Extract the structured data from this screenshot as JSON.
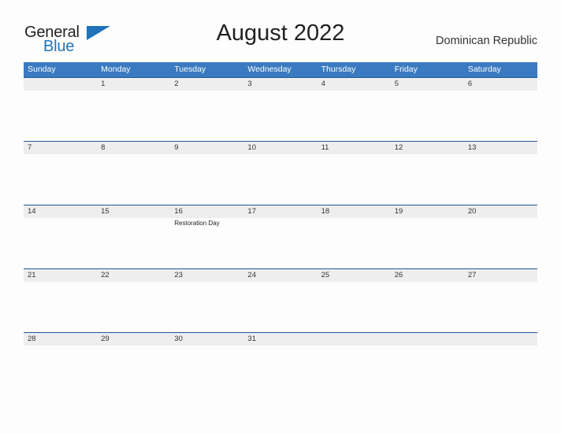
{
  "logo": {
    "word_one": "General",
    "word_two": "Blue",
    "flag_icon": "triangle-flag-icon"
  },
  "header": {
    "title": "August 2022",
    "region": "Dominican Republic"
  },
  "calendar": {
    "weekday_headers": [
      "Sunday",
      "Monday",
      "Tuesday",
      "Wednesday",
      "Thursday",
      "Friday",
      "Saturday"
    ],
    "colors": {
      "header_blue": "#3a7ac0",
      "row_band_gray": "#efeeee",
      "row_rule_blue": "#1c5a96",
      "logo_blue": "#1f73b8",
      "text_dark": "#333333",
      "page_bg": "#fdfdfd"
    },
    "weeks": [
      [
        {
          "day": "",
          "events": []
        },
        {
          "day": "1",
          "events": []
        },
        {
          "day": "2",
          "events": []
        },
        {
          "day": "3",
          "events": []
        },
        {
          "day": "4",
          "events": []
        },
        {
          "day": "5",
          "events": []
        },
        {
          "day": "6",
          "events": []
        }
      ],
      [
        {
          "day": "7",
          "events": []
        },
        {
          "day": "8",
          "events": []
        },
        {
          "day": "9",
          "events": []
        },
        {
          "day": "10",
          "events": []
        },
        {
          "day": "11",
          "events": []
        },
        {
          "day": "12",
          "events": []
        },
        {
          "day": "13",
          "events": []
        }
      ],
      [
        {
          "day": "14",
          "events": []
        },
        {
          "day": "15",
          "events": []
        },
        {
          "day": "16",
          "events": [
            "Restoration Day"
          ]
        },
        {
          "day": "17",
          "events": []
        },
        {
          "day": "18",
          "events": []
        },
        {
          "day": "19",
          "events": []
        },
        {
          "day": "20",
          "events": []
        }
      ],
      [
        {
          "day": "21",
          "events": []
        },
        {
          "day": "22",
          "events": []
        },
        {
          "day": "23",
          "events": []
        },
        {
          "day": "24",
          "events": []
        },
        {
          "day": "25",
          "events": []
        },
        {
          "day": "26",
          "events": []
        },
        {
          "day": "27",
          "events": []
        }
      ],
      [
        {
          "day": "28",
          "events": []
        },
        {
          "day": "29",
          "events": []
        },
        {
          "day": "30",
          "events": []
        },
        {
          "day": "31",
          "events": []
        },
        {
          "day": "",
          "events": []
        },
        {
          "day": "",
          "events": []
        },
        {
          "day": "",
          "events": []
        }
      ]
    ]
  }
}
